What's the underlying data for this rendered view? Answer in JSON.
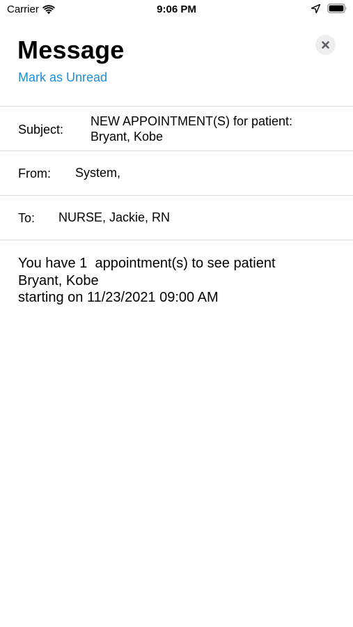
{
  "status_bar": {
    "carrier": "Carrier",
    "time": "9:06 PM",
    "icons": [
      "wifi-icon",
      "location-icon",
      "battery-icon"
    ]
  },
  "header": {
    "title": "Message",
    "mark_unread_label": "Mark as Unread",
    "close_icon": "close-icon",
    "link_color": "#1e8fd8"
  },
  "fields": {
    "subject_label": "Subject:",
    "subject_line1": "NEW  APPOINTMENT(S) for patient:",
    "subject_line2": "Bryant, Kobe",
    "from_label": "From:",
    "from_value": "System,",
    "to_label": "To:",
    "to_value": "NURSE, Jackie, RN"
  },
  "body": {
    "line1": "You have 1  appointment(s) to see patient",
    "line2": "Bryant, Kobe",
    "line3": "starting on 11/23/2021 09:00 AM"
  }
}
